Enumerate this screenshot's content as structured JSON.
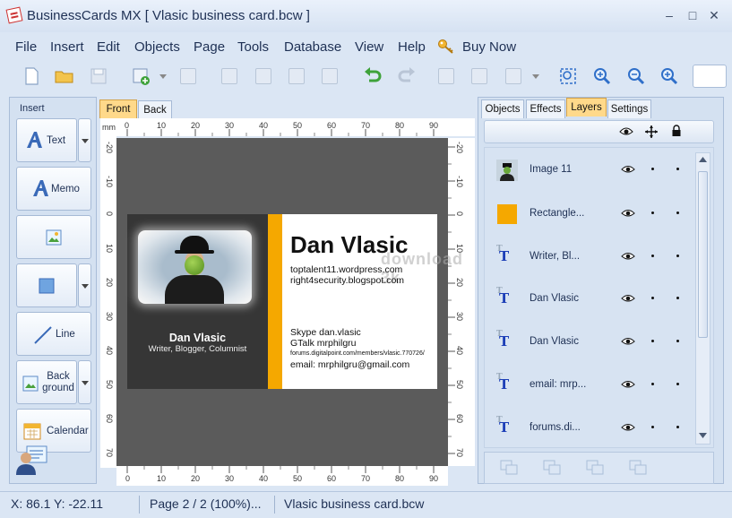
{
  "window": {
    "title": "BusinessCards MX [ Vlasic business card.bcw ]",
    "controls": [
      "–",
      "□",
      "✕"
    ]
  },
  "menu": [
    "File",
    "Insert",
    "Edit",
    "Objects",
    "Page",
    "Tools",
    "Database",
    "View",
    "Help",
    "Buy Now"
  ],
  "insert_panel": {
    "title": "Insert",
    "buttons": [
      "Text",
      "Memo",
      "",
      "",
      "Line",
      "Back ground",
      "Calendar"
    ]
  },
  "canvas_tabs": [
    "Front",
    "Back"
  ],
  "ruler": {
    "unit": "mm",
    "top": [
      "0",
      "10",
      "20",
      "30",
      "40",
      "50",
      "60",
      "70",
      "80",
      "90"
    ],
    "left": [
      "-20",
      "-10",
      "0",
      "10",
      "20",
      "30",
      "40",
      "50",
      "60",
      "70"
    ],
    "right": [
      "-20",
      "-10",
      "0",
      "10",
      "20",
      "30",
      "40",
      "50",
      "60",
      "70"
    ],
    "bottom": [
      "0",
      "10",
      "20",
      "30",
      "40",
      "50",
      "60",
      "70",
      "80",
      "90"
    ]
  },
  "card": {
    "left_name": "Dan Vlasic",
    "left_role": "Writer, Blogger, Columnist",
    "big_name": "Dan Vlasic",
    "site1": "toptalent11.wordpress.com",
    "site2": "right4security.blogspot.com",
    "skype": "Skype dan.vlasic",
    "gtalk": "GTalk mrphilgru",
    "forum": "forums.digitalpoint.com/members/vlasic.770726/",
    "email": "email: mrphilgru@gmail.com",
    "watermark": "download 3k",
    "colors": {
      "left": "#363636",
      "stripe": "#f5a800",
      "right": "#ffffff"
    }
  },
  "right_tabs": [
    "Objects",
    "Effects",
    "Layers",
    "Settings"
  ],
  "active_right_tab": "Layers",
  "layers": [
    {
      "name": "Image 11",
      "icon": "image-thumb-icon"
    },
    {
      "name": "Rectangle...",
      "icon": "rectangle-thumb-icon"
    },
    {
      "name": "Writer, Bl...",
      "icon": "text-layer-icon"
    },
    {
      "name": "Dan Vlasic",
      "icon": "text-layer-icon"
    },
    {
      "name": "Dan Vlasic",
      "icon": "text-layer-icon"
    },
    {
      "name": "email: mrp...",
      "icon": "text-layer-icon"
    },
    {
      "name": "forums.di...",
      "icon": "text-layer-icon"
    }
  ],
  "status": {
    "coords": "X: 86.1 Y: -22.11",
    "page": "Page 2 / 2 (100%)...",
    "file": "Vlasic business card.bcw"
  }
}
